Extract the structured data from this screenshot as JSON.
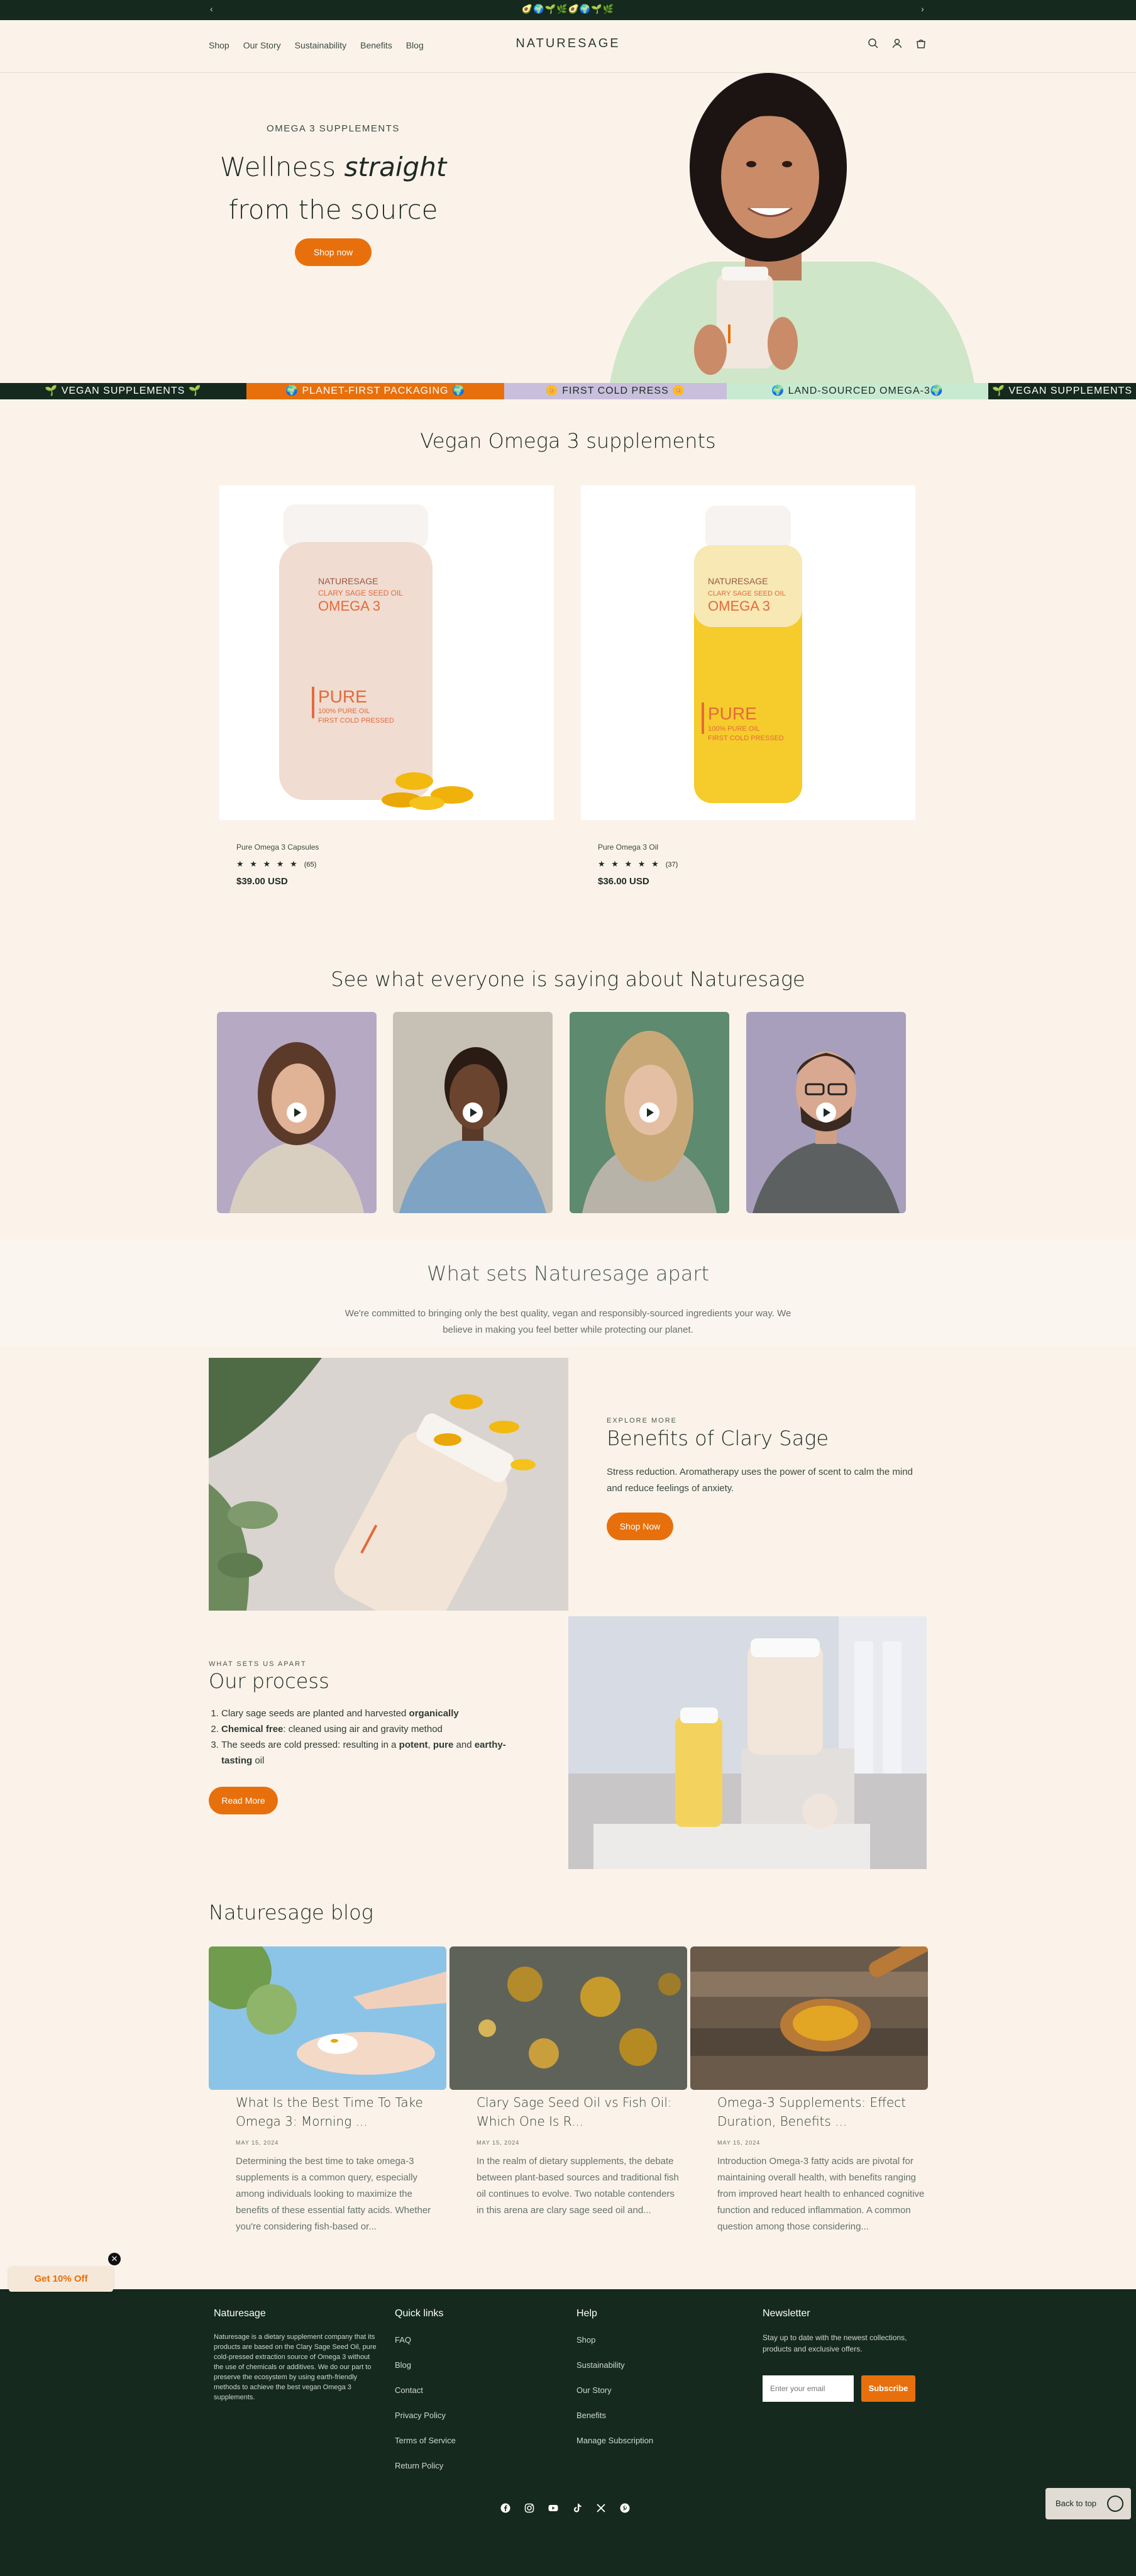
{
  "announcement": {
    "prev": "‹",
    "next": "›",
    "emoji": "🥑🌍🌱🌿🥑🌍🌱🌿"
  },
  "header": {
    "nav": [
      "Shop",
      "Our Story",
      "Sustainability",
      "Benefits",
      "Blog"
    ],
    "logo": "NATURESAGE",
    "icons": [
      "search-icon",
      "account-icon",
      "cart-icon"
    ]
  },
  "hero": {
    "eyebrow": "OMEGA 3 SUPPLEMENTS",
    "title_a": "Wellness ",
    "title_em": "straight",
    "title_b": "from the source",
    "cta": "Shop now"
  },
  "marquee": [
    {
      "text": "🌱 VEGAN SUPPLEMENTS 🌱",
      "bg": "#15291f",
      "fg": "#ffffff"
    },
    {
      "text": "🌍 PLANET-FIRST PACKAGING 🌍",
      "bg": "#e7700d",
      "fg": "#ffffff"
    },
    {
      "text": "🌼 FIRST COLD PRESS 🌼",
      "bg": "#c9bfdc",
      "fg": "#1e2a23"
    },
    {
      "text": "🌍 LAND-SOURCED OMEGA-3🌍",
      "bg": "#c8ead1",
      "fg": "#1e2a23"
    },
    {
      "text": "🌱 VEGAN SUPPLEMENTS",
      "bg": "#15291f",
      "fg": "#ffffff"
    }
  ],
  "products": {
    "title": "Vegan Omega 3 supplements",
    "items": [
      {
        "name": "Pure Omega 3 Capsules",
        "stars": "★ ★ ★ ★ ★",
        "count": "(65)",
        "price": "$39.00 USD"
      },
      {
        "name": "Pure Omega 3 Oil",
        "stars": "★ ★ ★ ★ ★",
        "count": "(37)",
        "price": "$36.00 USD"
      }
    ],
    "bottle": {
      "brand": "NATURESAGE",
      "sub": "CLARY SAGE SEED OIL",
      "name": "OMEGA 3",
      "pure": "PURE",
      "line1": "100% PURE OIL",
      "line2": "FIRST COLD PRESSED"
    }
  },
  "testimonials": {
    "title": "See what everyone is saying about Naturesage",
    "colors": [
      "#b6a9c4",
      "#c7c0b4",
      "#5e8a6f",
      "#a79fbc"
    ]
  },
  "apart": {
    "title": "What sets Naturesage apart",
    "desc": "We're committed to bringing only the best quality, vegan and responsibly-sourced ingredients your way. We believe in making you feel better while protecting our planet."
  },
  "clary": {
    "eyebrow": "EXPLORE MORE",
    "title": "Benefits of Clary Sage",
    "text": "Stress reduction. Aromatherapy uses the power of scent to calm the mind and reduce feelings of anxiety.",
    "cta": "Shop Now"
  },
  "process": {
    "eyebrow": "WHAT SETS US APART",
    "title": "Our process",
    "step1_a": "Clary sage seeds are planted and harvested ",
    "step1_b": "organically",
    "step2_a": "Chemical free",
    "step2_b": ": cleaned using air and gravity method",
    "step3_a": "The seeds are cold pressed: resulting in a ",
    "step3_b": "potent",
    "step3_c": ", ",
    "step3_d": "pure",
    "step3_e": " and ",
    "step3_f": "earthy-tasting",
    "step3_g": " oil",
    "cta": "Read More"
  },
  "blog": {
    "title": "Naturesage blog",
    "posts": [
      {
        "title": "What Is the Best Time To Take Omega 3: Morning ...",
        "date": "MAY 15, 2024",
        "excerpt": "Determining the best time to take omega-3 supplements is a common query, especially among individuals looking to maximize the benefits of these essential fatty acids. Whether you're considering fish-based or..."
      },
      {
        "title": "Clary Sage Seed Oil vs Fish Oil: Which One Is R...",
        "date": "MAY 15, 2024",
        "excerpt": "In the realm of dietary supplements, the debate between plant-based sources and traditional fish oil continues to evolve. Two notable contenders in this arena are clary sage seed oil and..."
      },
      {
        "title": "Omega-3 Supplements: Effect Duration, Benefits ...",
        "date": "MAY 15, 2024",
        "excerpt": "Introduction Omega-3 fatty acids are pivotal for maintaining overall health, with benefits ranging from improved heart health to enhanced cognitive function and reduced inflammation. A common question among those considering..."
      }
    ]
  },
  "promo": {
    "label": "Get 10% Off",
    "close": "✕"
  },
  "footer": {
    "about_title": "Naturesage",
    "about_text": "Naturesage is a dietary supplement company that its products are based on the Clary Sage Seed Oil, pure cold-pressed extraction source of Omega 3 without the use of chemicals or additives. We do our part to preserve the ecosystem by using earth-friendly methods to achieve the best vegan Omega 3 supplements.",
    "quick_title": "Quick links",
    "quick_links": [
      "FAQ",
      "Blog",
      "Contact",
      "Privacy Policy",
      "Terms of Service",
      "Return Policy"
    ],
    "help_title": "Help",
    "help_links": [
      "Shop",
      "Sustainability",
      "Our Story",
      "Benefits",
      "Manage Subscription"
    ],
    "nl_title": "Newsletter",
    "nl_text": "Stay up to date with the newest collections, products and exclusive offers.",
    "nl_placeholder": "Enter your email",
    "nl_button": "Subscribe",
    "social": [
      "facebook-icon",
      "instagram-icon",
      "youtube-icon",
      "tiktok-icon",
      "x-icon",
      "pinterest-icon"
    ],
    "back_to_top": "Back to top"
  }
}
